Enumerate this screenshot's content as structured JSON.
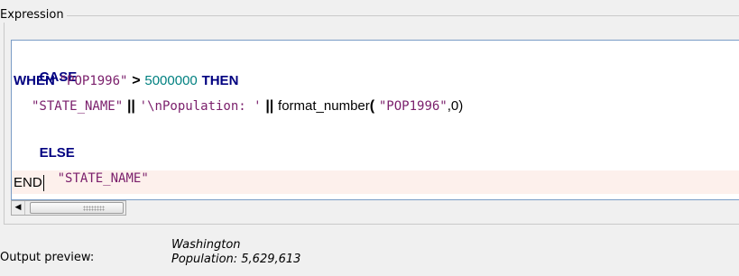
{
  "window": {
    "group_title": "Expression"
  },
  "editor": {
    "line1_kw": "CASE",
    "line2_when": "WHEN",
    "line2_field": "\"POP1996\"",
    "line2_op": ">",
    "line2_num": "5000000",
    "line2_then": "THEN",
    "line3_field": "\"STATE_NAME\"",
    "line3_concat1": "||",
    "line3_str": "'\\nPopulation: '",
    "line3_concat2": "||",
    "line3_func": "format_number",
    "line3_paren": "(",
    "line3_arg_field": "\"POP1996\"",
    "line3_arg_rest": ",0)",
    "line4_kw": "ELSE",
    "line5_field": "\"STATE_NAME\"",
    "line6_kw": "END"
  },
  "scrollbar": {
    "left_arrow": "◀"
  },
  "output_preview": {
    "label": "Output preview:",
    "line1": "Washington",
    "line2": "Population: 5,629,613"
  }
}
